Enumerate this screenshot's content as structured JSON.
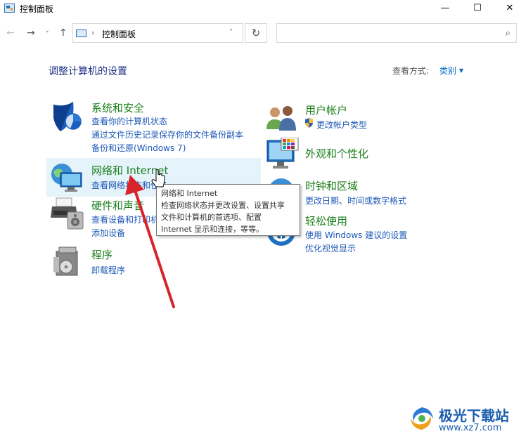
{
  "window": {
    "title": "控制面板",
    "minimize": "—",
    "maximize": "☐",
    "close": "✕"
  },
  "nav": {
    "back": "←",
    "forward": "→",
    "recent": "˅",
    "up": "↑",
    "separator": "›",
    "address": "控制面板",
    "address_dropdown": "˅",
    "refresh": "↻",
    "search_placeholder": "",
    "search_icon": "⌕"
  },
  "main": {
    "heading": "调整计算机的设置",
    "view_label": "查看方式:",
    "view_value": "类别"
  },
  "categories": {
    "system": {
      "title": "系统和安全",
      "links": [
        "查看你的计算机状态",
        "通过文件历史记录保存你的文件备份副本",
        "备份和还原(Windows 7)"
      ]
    },
    "network": {
      "title": "网络和 Internet",
      "links": [
        "查看网络状态和任务"
      ]
    },
    "hardware": {
      "title": "硬件和声音",
      "links": [
        "查看设备和打印机",
        "添加设备"
      ]
    },
    "programs": {
      "title": "程序",
      "links": [
        "卸载程序"
      ]
    },
    "users": {
      "title": "用户帐户",
      "links": [
        "更改帐户类型"
      ]
    },
    "appearance": {
      "title": "外观和个性化",
      "links": []
    },
    "clock": {
      "title": "时钟和区域",
      "links": [
        "更改日期、时间或数字格式"
      ]
    },
    "ease": {
      "title": "轻松使用",
      "links": [
        "使用 Windows 建议的设置",
        "优化视觉显示"
      ]
    }
  },
  "tooltip": {
    "lines": [
      "网络和 Internet",
      "检查网络状态并更改设置、设置共享",
      "文件和计算机的首选项、配置",
      "Internet 显示和连接，等等。"
    ]
  },
  "watermark": {
    "name": "极光下载站",
    "url": "www.xz7.com"
  },
  "colors": {
    "category_title": "#1a7f1a",
    "link": "#1e58b8",
    "heading": "#1e3287",
    "hover": "#e5f3fb",
    "arrow": "#d9232a"
  }
}
